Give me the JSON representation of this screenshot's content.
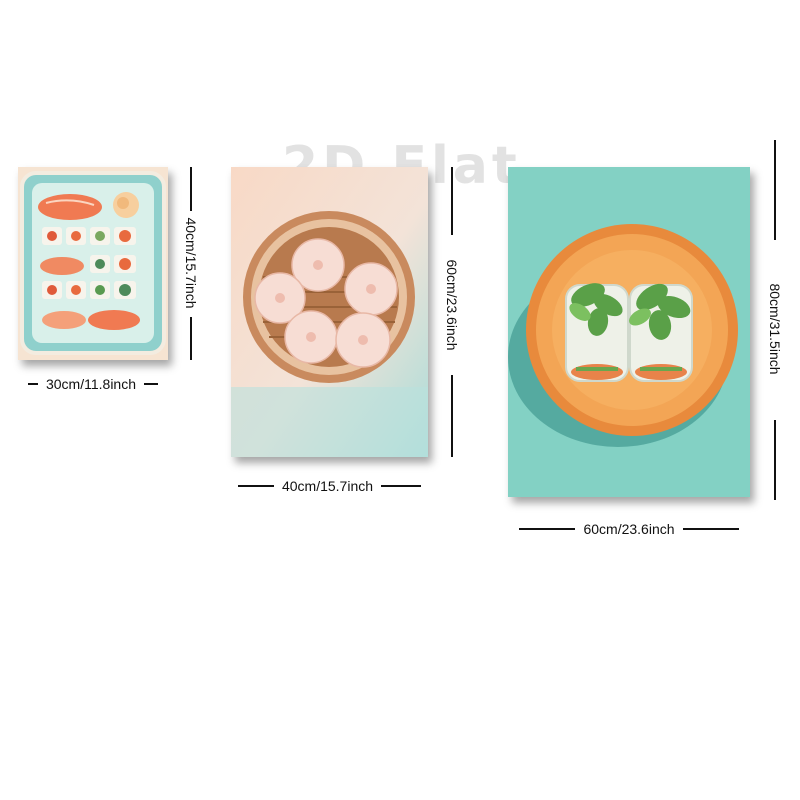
{
  "watermark": "2D Flat",
  "posters": [
    {
      "subject": "sushi",
      "width_label": "30cm/11.8inch",
      "height_label": "40cm/15.7inch"
    },
    {
      "subject": "dumplings",
      "width_label": "40cm/15.7inch",
      "height_label": "60cm/23.6inch"
    },
    {
      "subject": "spring rolls",
      "width_label": "60cm/23.6inch",
      "height_label": "80cm/31.5inch"
    }
  ],
  "colors": {
    "teal": "#7ccdc0",
    "peach": "#f5d8c4",
    "orange": "#ec9a4e",
    "salmon": "#f28a66"
  }
}
